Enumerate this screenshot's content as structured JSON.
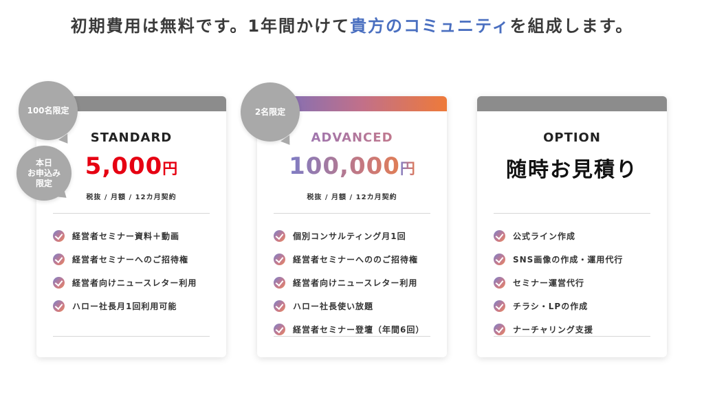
{
  "headline": {
    "prefix": "初期費用は無料です。1年間かけて",
    "accent": "貴方のコミュニティ",
    "suffix": "を組成します。",
    "accent_color": "#4a6fc0"
  },
  "badges": {
    "standard_limit": "100名限定",
    "standard_today": "本日\nお申込み\n限定",
    "advanced_limit": "2名限定"
  },
  "plans": [
    {
      "name": "STANDARD",
      "price": "5,000",
      "unit": "円",
      "terms": "税抜 / 月額 / 12カ月契約",
      "features": [
        "経営者セミナー資料＋動画",
        "経営者セミナーへのご招待権",
        "経営者向けニュースレター利用",
        "ハロー社長月1回利用可能"
      ]
    },
    {
      "name": "ADVANCED",
      "price": "100,000",
      "unit": "円",
      "terms": "税抜 / 月額 / 12カ月契約",
      "features": [
        "個別コンサルティング月1回",
        "経営者セミナーへののご招待権",
        "経営者向けニュースレター利用",
        "ハロー社長使い放題",
        "経営者セミナー登壇（年間6回）"
      ]
    },
    {
      "name": "OPTION",
      "price": "随時お見積り",
      "features": [
        "公式ライン作成",
        "SNS画像の作成・運用代行",
        "セミナー運営代行",
        "チラシ・LPの作成",
        "ナーチャリング支援"
      ]
    }
  ],
  "icons": {
    "feature_bullet": "check-circle-icon"
  },
  "colors": {
    "standard_price": "#e60012",
    "standard_bar": "#8c8c8c",
    "advanced_gradient_start": "#6b6fc4",
    "advanced_gradient_end": "#ee7a3a",
    "badge": "#a9a9a9"
  }
}
